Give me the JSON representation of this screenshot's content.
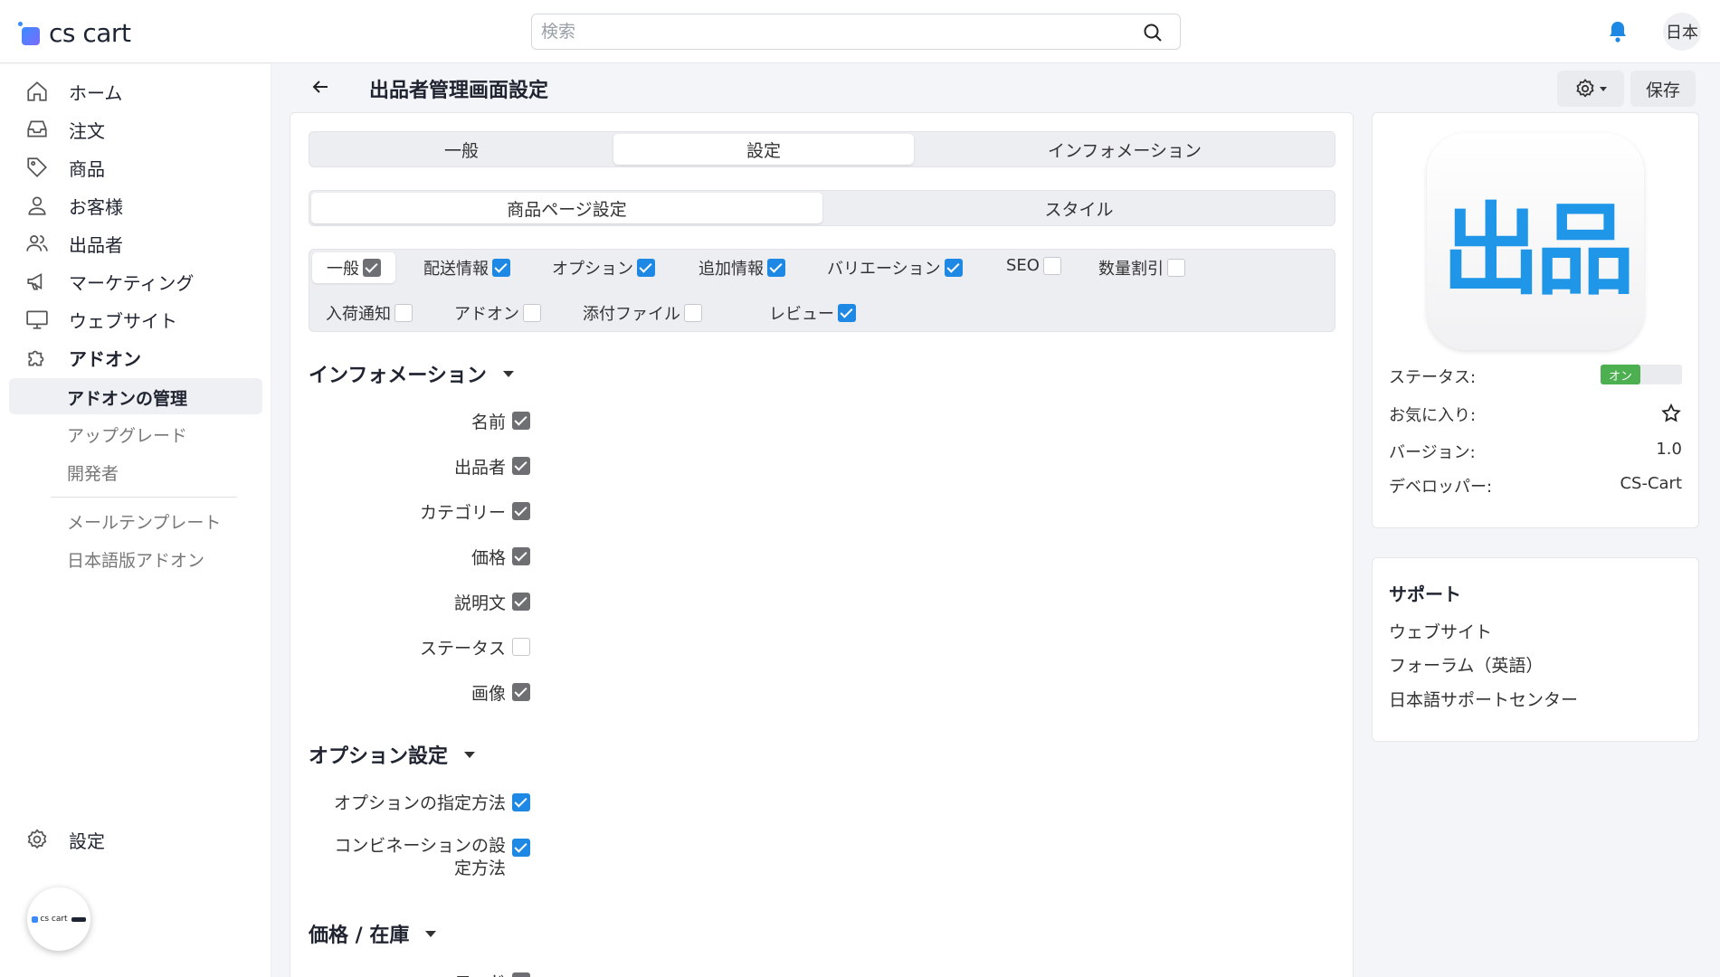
{
  "header": {
    "logo_text": "cs cart",
    "search_placeholder": "検索",
    "lang_label": "日本"
  },
  "sidebar": {
    "items": [
      {
        "label": "ホーム",
        "icon": "home-icon"
      },
      {
        "label": "注文",
        "icon": "inbox-icon"
      },
      {
        "label": "商品",
        "icon": "tag-icon"
      },
      {
        "label": "お客様",
        "icon": "user-icon"
      },
      {
        "label": "出品者",
        "icon": "users-icon"
      },
      {
        "label": "マーケティング",
        "icon": "megaphone-icon"
      },
      {
        "label": "ウェブサイト",
        "icon": "monitor-icon"
      },
      {
        "label": "アドオン",
        "icon": "puzzle-icon"
      }
    ],
    "sub_items": [
      "アドオンの管理",
      "アップグレード",
      "開発者"
    ],
    "extra_items": [
      "メールテンプレート",
      "日本語版アドオン"
    ],
    "settings_label": "設定",
    "fab_label": "cs cart"
  },
  "page": {
    "title": "出品者管理画面設定",
    "save_label": "保存"
  },
  "tabs": [
    "一般",
    "設定",
    "インフォメーション"
  ],
  "sub_tabs": [
    "商品ページ設定",
    "スタイル"
  ],
  "filters": [
    {
      "label": "一般",
      "checked": true,
      "style": "gray"
    },
    {
      "label": "配送情報",
      "checked": true,
      "style": "blue"
    },
    {
      "label": "オプション",
      "checked": true,
      "style": "blue"
    },
    {
      "label": "追加情報",
      "checked": true,
      "style": "blue"
    },
    {
      "label": "バリエーション",
      "checked": true,
      "style": "blue"
    },
    {
      "label": "SEO",
      "checked": false,
      "style": "empty"
    },
    {
      "label": "数量割引",
      "checked": false,
      "style": "empty"
    },
    {
      "label": "入荷通知",
      "checked": false,
      "style": "empty"
    },
    {
      "label": "アドオン",
      "checked": false,
      "style": "empty"
    },
    {
      "label": "添付ファイル",
      "checked": false,
      "style": "empty"
    },
    {
      "label": "レビュー",
      "checked": true,
      "style": "blue"
    }
  ],
  "sections": {
    "info": {
      "title": "インフォメーション",
      "rows": [
        {
          "label": "名前",
          "checked": true
        },
        {
          "label": "出品者",
          "checked": true
        },
        {
          "label": "カテゴリー",
          "checked": true
        },
        {
          "label": "価格",
          "checked": true
        },
        {
          "label": "説明文",
          "checked": true
        },
        {
          "label": "ステータス",
          "checked": false
        },
        {
          "label": "画像",
          "checked": true
        }
      ]
    },
    "options": {
      "title": "オプション設定",
      "rows": [
        {
          "label": "オプションの指定方法",
          "checked": true
        },
        {
          "label_line1": "コンビネーションの設",
          "label_line2": "定方法",
          "checked": true
        }
      ]
    },
    "price": {
      "title": "価格 / 在庫",
      "partial_row": "コード"
    }
  },
  "addon_info": {
    "logo_text": "出品",
    "status_label": "ステータス:",
    "status_value": "オン",
    "favorite_label": "お気に入り:",
    "version_label": "バージョン:",
    "version_value": "1.0",
    "developer_label": "デベロッパー:",
    "developer_value": "CS-Cart"
  },
  "support": {
    "title": "サポート",
    "links": [
      "ウェブサイト",
      "フォーラム（英語）",
      "日本語サポートセンター"
    ]
  },
  "colors": {
    "accent_blue": "#1e88e5",
    "toggle_on": "#4caf50",
    "logo_text_blue": "#1f96e8"
  }
}
